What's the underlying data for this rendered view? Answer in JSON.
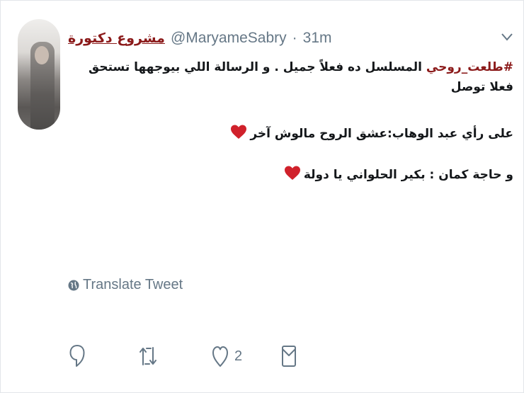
{
  "tweet": {
    "author_name": "مشروع دكتورة",
    "handle": "@MaryameSabry",
    "separator": "·",
    "time": "31m",
    "hashtag": "#طلعت_روحي",
    "line1_rest": " المسلسل ده فعلاً جميل . و الرسالة اللي بيوجهها تستحق",
    "line2": "فعلا توصل",
    "line3": "على رأي عبد الوهاب:عشق الروح مالوش آخر",
    "line4": "و حاجة كمان : بكير الحلواني يا دولة",
    "translate_label": "Translate Tweet",
    "like_count": "2"
  },
  "colors": {
    "name": "#8b1a1a",
    "hashtag": "#8b1a1a",
    "muted": "#657786",
    "heart": "#d0212b",
    "text": "#14171a"
  },
  "icons": {
    "avatar": "profile-photo",
    "menu": "chevron-down-icon",
    "globe": "globe-icon",
    "reply": "reply-icon",
    "retweet": "retweet-icon",
    "like": "heart-outline-icon",
    "dm": "direct-message-icon",
    "emoji": "red-heart-emoji"
  }
}
